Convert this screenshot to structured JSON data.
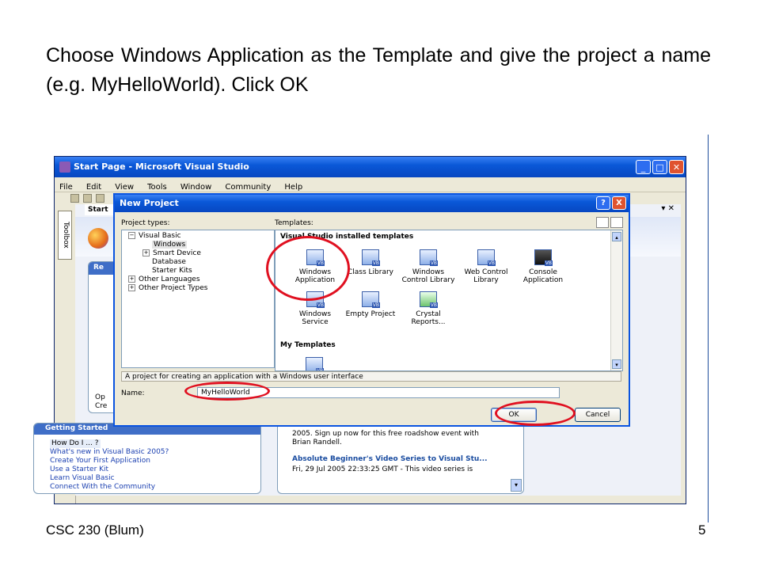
{
  "slide": {
    "title": "Choose Windows Application as the Template and give the project a name (e.g. MyHelloWorld). Click OK",
    "footer_left": "CSC 230 (Blum)",
    "footer_right": "5"
  },
  "vs_window": {
    "title": "Start Page - Microsoft Visual Studio",
    "menu": [
      "File",
      "Edit",
      "View",
      "Tools",
      "Window",
      "Community",
      "Help"
    ],
    "toolbox_label": "Toolbox",
    "doc_tab": "Start",
    "recent_panel_fragments": [
      "Re",
      "Op",
      "Cre"
    ],
    "getting_started": {
      "header": "Getting Started",
      "items": [
        "How Do I ... ?",
        "What's new in Visual Basic 2005?",
        "Create Your First Application",
        "Use a Starter Kit",
        "Learn Visual Basic",
        "Connect With the Community"
      ]
    },
    "news": {
      "line1": "2005.  Sign up now for this free roadshow event with",
      "line2": "Brian Randell.",
      "link": "Absolute Beginner's Video Series to Visual Stu...",
      "line3": "Fri, 29 Jul 2005 22:33:25 GMT - This video series is"
    }
  },
  "dialog": {
    "title": "New Project",
    "help_glyph": "?",
    "close_glyph": "X",
    "project_types_label": "Project types:",
    "templates_label": "Templates:",
    "tree": [
      {
        "label": "Visual Basic",
        "expander": "−"
      },
      {
        "label": "Windows",
        "selected": true
      },
      {
        "label": "Smart Device",
        "expander": "+"
      },
      {
        "label": "Database"
      },
      {
        "label": "Starter Kits"
      },
      {
        "label": "Other Languages",
        "expander": "+"
      },
      {
        "label": "Other Project Types",
        "expander": "+"
      }
    ],
    "installed_header": "Visual Studio installed templates",
    "templates": [
      {
        "label1": "Windows",
        "label2": "Application"
      },
      {
        "label1": "Class Library",
        "label2": ""
      },
      {
        "label1": "Windows",
        "label2": "Control Library"
      },
      {
        "label1": "Web Control",
        "label2": "Library"
      },
      {
        "label1": "Console",
        "label2": "Application"
      },
      {
        "label1": "Windows",
        "label2": "Service"
      },
      {
        "label1": "Empty Project",
        "label2": ""
      },
      {
        "label1": "Crystal",
        "label2": "Reports..."
      }
    ],
    "my_templates_header": "My Templates",
    "description": "A project for creating an application with a Windows user interface",
    "name_label": "Name:",
    "name_value": "MyHelloWorld",
    "ok_label": "OK",
    "cancel_label": "Cancel"
  },
  "colors": {
    "annotation_ring": "#e01020",
    "titlebar_blue": "#0a58d8",
    "slide_rule": "#1f4e9c"
  }
}
